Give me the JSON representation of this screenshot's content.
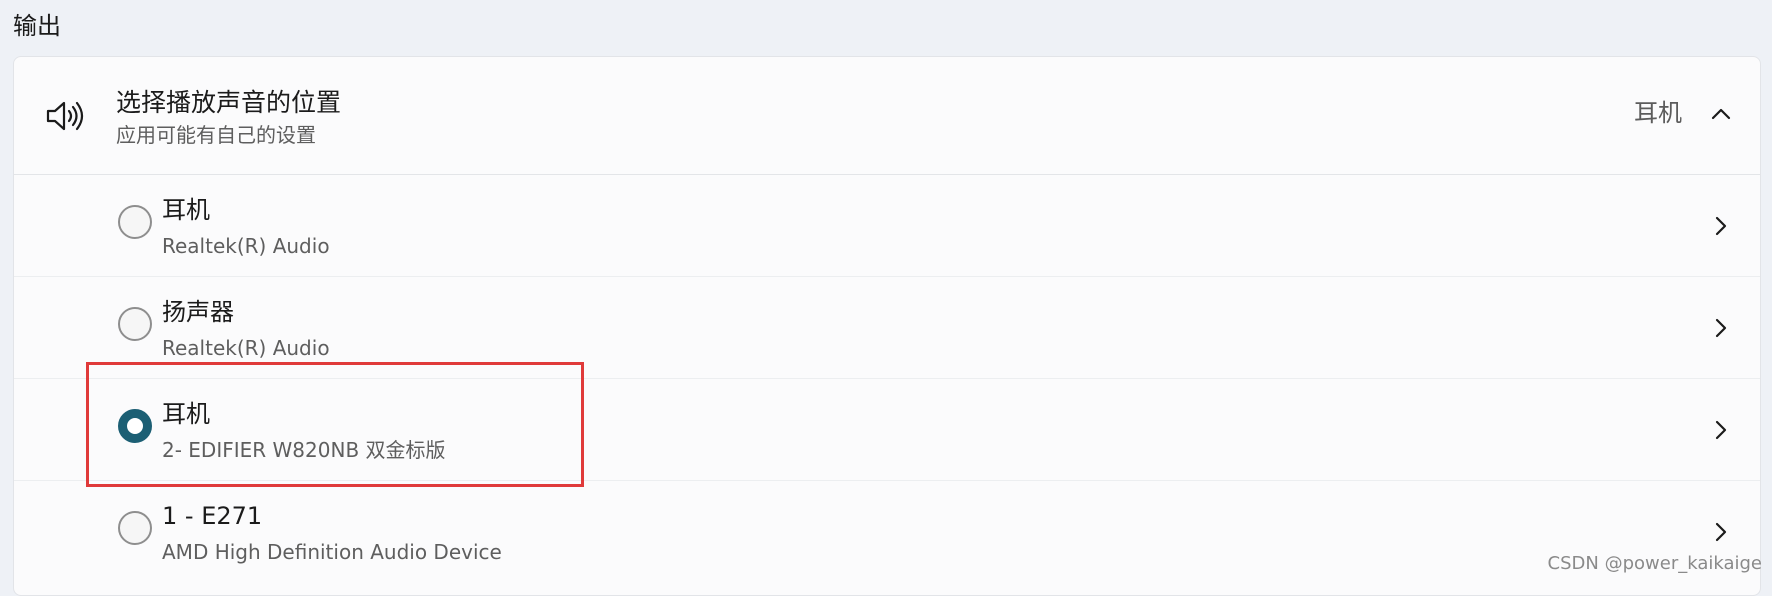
{
  "section": {
    "title": "输出"
  },
  "output_card": {
    "icon": "speaker-icon",
    "title": "选择播放声音的位置",
    "subtitle": "应用可能有自己的设置",
    "current_value": "耳机",
    "collapse_icon": "chevron-up-icon"
  },
  "devices": [
    {
      "name": "耳机",
      "detail": "Realtek(R) Audio",
      "selected": false
    },
    {
      "name": "扬声器",
      "detail": "Realtek(R) Audio",
      "selected": false
    },
    {
      "name": "耳机",
      "detail": "2- EDIFIER W820NB 双金标版",
      "selected": true
    },
    {
      "name": "1 - E271",
      "detail": "AMD High Definition Audio Device",
      "selected": false
    }
  ],
  "colors": {
    "accent": "#1c5f74",
    "highlight": "#e03a3a",
    "background": "#eef1f6",
    "card": "#fbfbfc"
  },
  "watermark": "CSDN @power_kaikaige"
}
